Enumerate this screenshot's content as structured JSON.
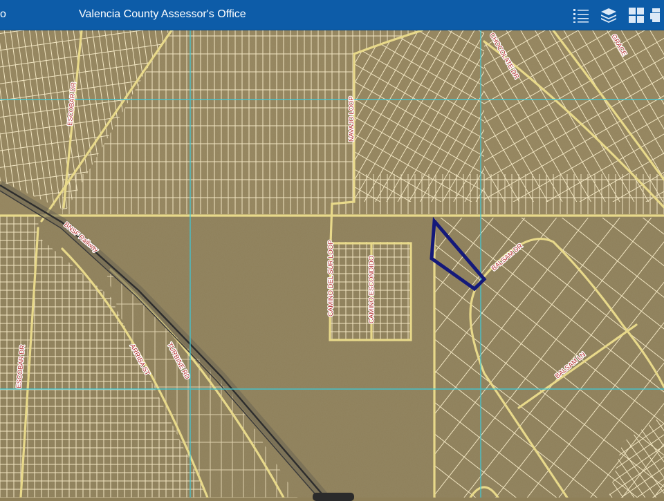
{
  "header": {
    "logo_fragment": "o",
    "title": "Valencia County Assessor's Office",
    "tools": [
      {
        "name": "legend-list-icon"
      },
      {
        "name": "layers-icon"
      },
      {
        "name": "basemap-gallery-icon"
      },
      {
        "name": "print-icon"
      }
    ],
    "bar_color": "#0d5ca8"
  },
  "map": {
    "labels": {
      "escobar_dr_north": "ESCOBAR DR",
      "escobar_dr_south": "ESCOBAR DR",
      "navajo_loop": "NAVAJO LOOP",
      "chocolate_dr": "CHOCOLATE DR",
      "grace": "GRACE",
      "bnsf_railway": "BNSF Railway",
      "camino_del_sur_loop": "CAMINO DEL SUR LOOP",
      "camino_escondido": "CAMINO ESCONDIDO",
      "balsam_dr": "BALSAM DR",
      "balsam_ln": "BALSAM LN",
      "arriba_st": "ARRIBA ST",
      "turbine_rd": "TURBINE RD"
    },
    "colors": {
      "terrain": "#8f8059",
      "parcel_lines": "#f2e6c2",
      "road_casing": "#e8d98a",
      "grid_lines": "#3ec8d6",
      "selected_parcel": "#14197a",
      "label_text": "#b3302f"
    }
  }
}
